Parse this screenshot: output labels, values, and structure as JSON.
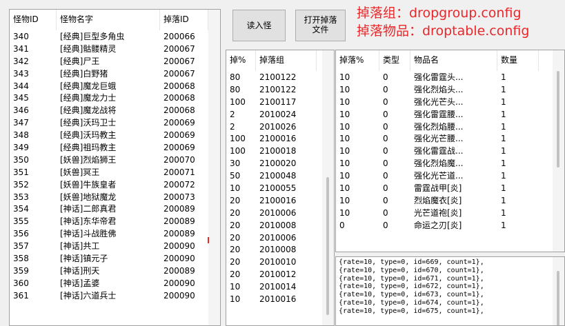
{
  "monster_list": {
    "headers": [
      "怪物ID",
      "怪物名字",
      "掉落ID"
    ],
    "rows": [
      [
        "340",
        "[经典]巨型多角虫",
        "200066"
      ],
      [
        "341",
        "[经典]骷髅精灵",
        "200067"
      ],
      [
        "342",
        "[经典]尸王",
        "200067"
      ],
      [
        "343",
        "[经典]白野猪",
        "200067"
      ],
      [
        "344",
        "[经典]魔龙巨蛾",
        "200068"
      ],
      [
        "345",
        "[经典]魔龙力士",
        "200068"
      ],
      [
        "346",
        "[经典]魔龙战将",
        "200068"
      ],
      [
        "347",
        "[经典]沃玛卫士",
        "200069"
      ],
      [
        "348",
        "[经典]沃玛教主",
        "200069"
      ],
      [
        "349",
        "[经典]祖玛教主",
        "200069"
      ],
      [
        "350",
        "[妖兽]烈焰狮王",
        "200070"
      ],
      [
        "351",
        "[妖兽]冥王",
        "200071"
      ],
      [
        "352",
        "[妖兽]牛族皇者",
        "200072"
      ],
      [
        "353",
        "[妖兽]地狱魔龙",
        "200073"
      ],
      [
        "354",
        "[神话]二郎真君",
        "200089"
      ],
      [
        "355",
        "[神话]东华帝君",
        "200089"
      ],
      [
        "356",
        "[神话]斗战胜佛",
        "200089"
      ],
      [
        "357",
        "[神话]共工",
        "200090"
      ],
      [
        "358",
        "[神话]镇元子",
        "200090"
      ],
      [
        "359",
        "[神话]刑天",
        "200089"
      ],
      [
        "360",
        "[神话]孟婆",
        "200090"
      ],
      [
        "361",
        "[神话]六道兵士",
        "200090"
      ]
    ]
  },
  "buttons": {
    "read_monster": "读入怪",
    "open_drop_line1": "打开掉落",
    "open_drop_line2": "文件"
  },
  "config_labels": {
    "drop_group": "掉落组：dropgroup.config",
    "drop_items": "掉落物品：droptable.config"
  },
  "drop_group_list": {
    "headers": [
      "掉%",
      "掉落组"
    ],
    "rows": [
      [
        "80",
        "2100122"
      ],
      [
        "80",
        "2100122"
      ],
      [
        "100",
        "2100117"
      ],
      [
        "2",
        "2010024"
      ],
      [
        "2",
        "2010026"
      ],
      [
        "100",
        "2100016"
      ],
      [
        "100",
        "2100018"
      ],
      [
        "30",
        "2100020"
      ],
      [
        "50",
        "2100048"
      ],
      [
        "10",
        "2100055"
      ],
      [
        "20",
        "2100016"
      ],
      [
        "20",
        "2010006"
      ],
      [
        "20",
        "2010008"
      ],
      [
        "20",
        "2010006"
      ],
      [
        "20",
        "2010008"
      ],
      [
        "20",
        "2010010"
      ],
      [
        "20",
        "2010012"
      ],
      [
        "10",
        "2010014"
      ],
      [
        "10",
        "2010016"
      ]
    ]
  },
  "item_list": {
    "headers": [
      "掉落%",
      "类型",
      "物品名",
      "数量"
    ],
    "rows": [
      [
        "10",
        "0",
        "强化雷霆头...",
        "1"
      ],
      [
        "10",
        "0",
        "强化烈焰头...",
        "1"
      ],
      [
        "10",
        "0",
        "强化光芒头...",
        "1"
      ],
      [
        "10",
        "0",
        "强化雷霆腰...",
        "1"
      ],
      [
        "10",
        "0",
        "强化烈焰腰...",
        "1"
      ],
      [
        "10",
        "0",
        "强化光芒腰...",
        "1"
      ],
      [
        "10",
        "0",
        "强化雷霆战...",
        "1"
      ],
      [
        "10",
        "0",
        "强化烈焰魔...",
        "1"
      ],
      [
        "10",
        "0",
        "强化光芒道...",
        "1"
      ],
      [
        "10",
        "0",
        "雷霆战甲[炎]",
        "1"
      ],
      [
        "10",
        "0",
        "烈焰魔衣[炎]",
        "1"
      ],
      [
        "10",
        "0",
        "光芒道袍[炎]",
        "1"
      ],
      [
        "0",
        "0",
        "命运之刃[炎]",
        "1"
      ]
    ]
  },
  "raw_lines": [
    "{rate=10, type=0, id=669, count=1},",
    "{rate=10, type=0, id=670, count=1},",
    "{rate=10, type=0, id=671, count=1},",
    "{rate=10, type=0, id=672, count=1},",
    "{rate=10, type=0, id=673, count=1},",
    "{rate=10, type=0, id=674, count=1},",
    "{rate=10, type=0, id=675, count=1},"
  ]
}
